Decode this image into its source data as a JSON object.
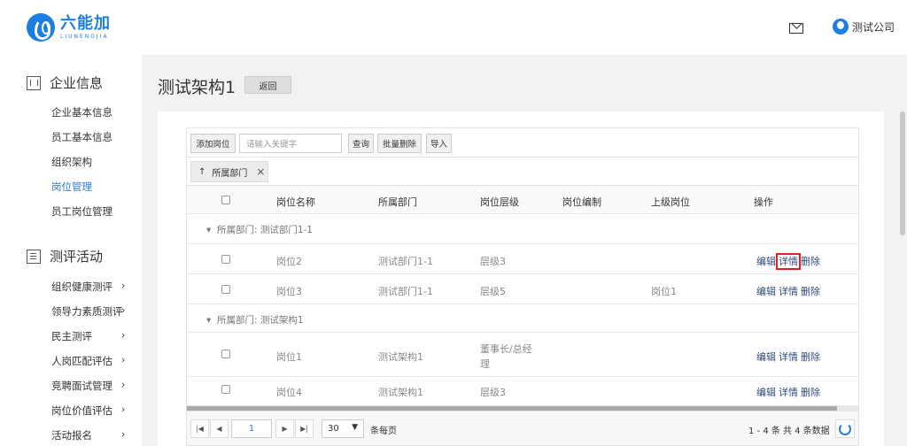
{
  "brand": {
    "name": "六能加",
    "sub": "LIUNENGJIA"
  },
  "header": {
    "user_name": "测试公司"
  },
  "sidebar": {
    "section1": {
      "title": "企业信息",
      "items": [
        "企业基本信息",
        "员工基本信息",
        "组织架构",
        "岗位管理",
        "员工岗位管理"
      ]
    },
    "section2": {
      "title": "测评活动",
      "items": [
        "组织健康测评",
        "领导力素质测评",
        "民主测评",
        "人岗匹配评估",
        "竞聘面试管理",
        "岗位价值评估",
        "活动报名"
      ]
    }
  },
  "page": {
    "title": "测试架构1",
    "back_label": "返回"
  },
  "toolbar": {
    "add_label": "添加岗位",
    "search_placeholder": "请输入关键字",
    "query_label": "查询",
    "batch_delete_label": "批量删除",
    "import_label": "导入"
  },
  "group_chip": {
    "label": "所属部门"
  },
  "table": {
    "columns": [
      "岗位名称",
      "所属部门",
      "岗位层级",
      "岗位编制",
      "上级岗位",
      "操作"
    ],
    "groups": [
      {
        "label": "所属部门: 测试部门1-1",
        "rows": [
          {
            "name": "岗位2",
            "dept": "测试部门1-1",
            "level": "层级3",
            "quota": "",
            "parent": ""
          },
          {
            "name": "岗位3",
            "dept": "测试部门1-1",
            "level": "层级5",
            "quota": "",
            "parent": "岗位1"
          }
        ]
      },
      {
        "label": "所属部门: 测试架构1",
        "rows": [
          {
            "name": "岗位1",
            "dept": "测试架构1",
            "level_line1": "董事长/总经",
            "level_line2": "理",
            "quota": "",
            "parent": ""
          },
          {
            "name": "岗位4",
            "dept": "测试架构1",
            "level": "层级3",
            "quota": "",
            "parent": ""
          }
        ]
      }
    ],
    "actions": {
      "edit": "编辑",
      "detail": "详情",
      "delete": "删除"
    }
  },
  "pager": {
    "page": "1",
    "page_size": "30",
    "per_page_label": "条每页",
    "range_text": "1 - 4 条",
    "total_text": "共 4 条数据"
  }
}
